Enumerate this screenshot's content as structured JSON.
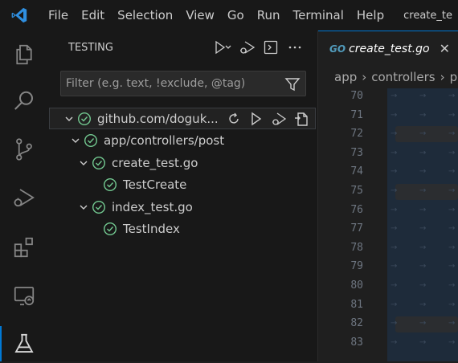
{
  "titlebar": {
    "menu": [
      "File",
      "Edit",
      "Selection",
      "View",
      "Go",
      "Run",
      "Terminal",
      "Help"
    ],
    "window_title": "create_te"
  },
  "activity_bar": {
    "items": [
      "explorer-icon",
      "search-icon",
      "source-control-icon",
      "run-debug-icon",
      "extensions-icon",
      "remote-explorer-icon",
      "testing-icon"
    ],
    "active": "testing-icon",
    "accent": "#0078d4"
  },
  "sidebar": {
    "title": "TESTING",
    "filter_placeholder": "Filter (e.g. text, !exclude, @tag)",
    "tree": [
      {
        "label": "github.com/doguk...",
        "level": 0,
        "status": "passed"
      },
      {
        "label": "app/controllers/post",
        "level": 1,
        "status": "passed"
      },
      {
        "label": "create_test.go",
        "level": 2,
        "status": "passed"
      },
      {
        "label": "TestCreate",
        "level": 3,
        "status": "passed"
      },
      {
        "label": "index_test.go",
        "level": 2,
        "status": "passed"
      },
      {
        "label": "TestIndex",
        "level": 3,
        "status": "passed"
      }
    ],
    "pass_color": "#73c991"
  },
  "editor": {
    "tab_label": "create_test.go",
    "tab_icon_text": "GO",
    "breadcrumbs": [
      "app",
      "controllers",
      "p"
    ],
    "line_numbers": [
      "70",
      "71",
      "72",
      "73",
      "74",
      "75",
      "76",
      "77",
      "78",
      "79",
      "80",
      "81",
      "82",
      "83"
    ]
  }
}
